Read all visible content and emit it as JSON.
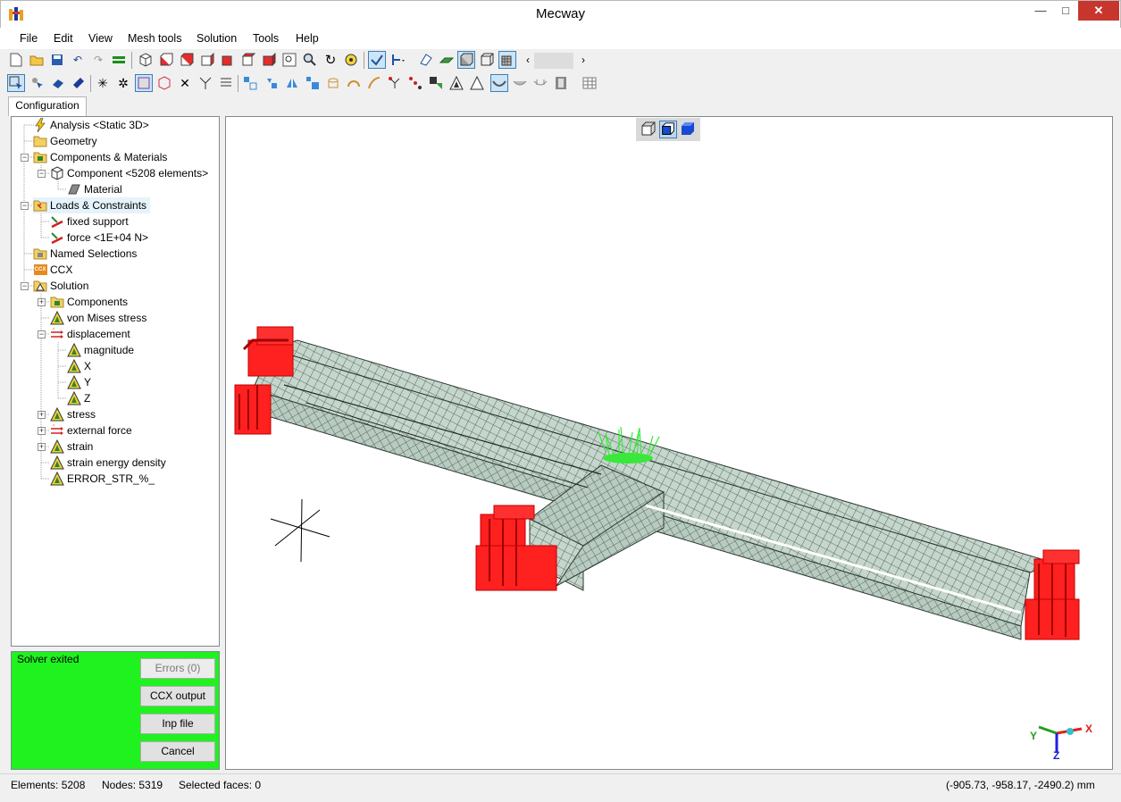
{
  "window": {
    "title": "Mecway",
    "minimize": "—",
    "maximize": "□",
    "close": "✕"
  },
  "menu": [
    "File",
    "Edit",
    "View",
    "Mesh tools",
    "Solution",
    "Tools",
    "Help"
  ],
  "toolbar1_icons": [
    "new-file-icon",
    "open-folder-icon",
    "save-icon",
    "undo-icon",
    "redo-icon",
    "equals-icon",
    "view-iso-icon",
    "view-front-icon",
    "view-back-icon",
    "view-left-icon",
    "view-right-icon",
    "view-top-icon",
    "view-bottom-icon",
    "zoom-window-icon",
    "zoom-icon",
    "rotate-icon",
    "zoom-fit-icon",
    "select-mode-icon",
    "select-dropdown-icon",
    "section-icon",
    "surface-icon",
    "shaded-icon",
    "wireframe-icon",
    "mesh-shaded-icon"
  ],
  "toolbar2_icons": [
    "select-element-icon",
    "select-node-icon",
    "select-face-icon",
    "select-edge-icon",
    "explode-icon",
    "explode-select-icon",
    "box-select-icon",
    "cube-select-icon",
    "delete-icon",
    "split-icon",
    "list-icon",
    "move-icon",
    "rotate-copy-icon",
    "mirror-icon",
    "scale-icon",
    "extrude-icon",
    "revolve-icon",
    "sweep-icon",
    "merge-icon",
    "refine-icon",
    "quality-icon",
    "triangle-icon",
    "triangle-outline-icon",
    "shell-icon",
    "shell2-icon",
    "shell3-icon",
    "film-icon",
    "table-icon"
  ],
  "tabs": {
    "configuration": "Configuration"
  },
  "tree": [
    {
      "label": "Analysis <Static 3D>",
      "icon": "lightning-icon"
    },
    {
      "label": "Geometry",
      "icon": "folder-icon"
    },
    {
      "label": "Components & Materials",
      "icon": "components-icon"
    },
    {
      "label": "Component <5208 elements>",
      "icon": "component-icon"
    },
    {
      "label": "Material",
      "icon": "material-icon"
    },
    {
      "label": "Loads & Constraints",
      "icon": "loads-icon"
    },
    {
      "label": "fixed support",
      "icon": "support-icon"
    },
    {
      "label": "force <1E+04 N>",
      "icon": "force-icon"
    },
    {
      "label": "Named Selections",
      "icon": "selections-icon"
    },
    {
      "label": "CCX",
      "icon": "ccx-icon"
    },
    {
      "label": "Solution",
      "icon": "solution-icon"
    },
    {
      "label": "Components",
      "icon": "components-icon"
    },
    {
      "label": "von Mises stress",
      "icon": "result-icon"
    },
    {
      "label": "displacement",
      "icon": "arrows-icon"
    },
    {
      "label": "magnitude",
      "icon": "result-icon"
    },
    {
      "label": "X",
      "icon": "result-icon"
    },
    {
      "label": "Y",
      "icon": "result-icon"
    },
    {
      "label": "Z",
      "icon": "result-icon"
    },
    {
      "label": "stress",
      "icon": "result-icon"
    },
    {
      "label": "external force",
      "icon": "arrows-icon"
    },
    {
      "label": "strain",
      "icon": "result-icon"
    },
    {
      "label": "strain energy density",
      "icon": "result-icon"
    },
    {
      "label": "ERROR_STR_%_",
      "icon": "result-icon"
    }
  ],
  "ccx_badge": "CCX",
  "solver": {
    "status": "Solver exited",
    "errors": "Errors (0)",
    "ccx_output": "CCX output",
    "inp_file": "Inp file",
    "cancel": "Cancel"
  },
  "triad": {
    "x": "X",
    "y": "Y",
    "z": "Z"
  },
  "status": {
    "elements": "Elements: 5208",
    "nodes": "Nodes: 5319",
    "selected": "Selected faces: 0",
    "coords": "(-905.73, -958.17, -2490.2) mm"
  },
  "colors": {
    "mesh_fill": "#c5d6cc",
    "mesh_line": "#3c4a44",
    "support": "#ff1a1a",
    "force": "#39e83a",
    "solver_ok": "#1ff21f"
  }
}
